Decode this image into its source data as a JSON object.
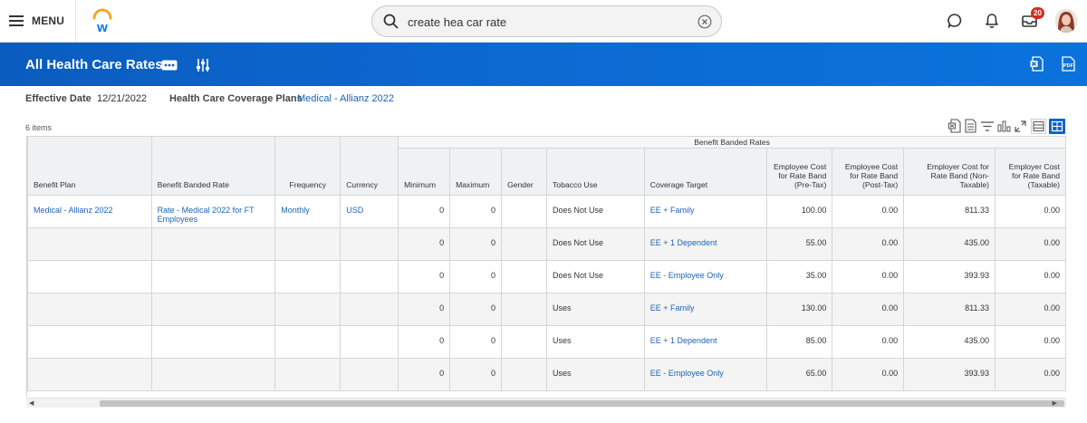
{
  "topbar": {
    "menu_label": "MENU",
    "search_value": "create hea car rate",
    "notification_count": "20"
  },
  "header": {
    "title": "All Health Care Rates"
  },
  "filters": {
    "effective_date_label": "Effective Date",
    "effective_date_value": "12/21/2022",
    "plans_label": "Health Care Coverage Plans",
    "plans_value": "Medical - Allianz 2022"
  },
  "grid": {
    "item_count": "6 items",
    "group_header": "Benefit Banded Rates",
    "columns": [
      "Benefit Plan",
      "Benefit Banded Rate",
      "Frequency",
      "Currency",
      "Minimum",
      "Maximum",
      "Gender",
      "Tobacco Use",
      "Coverage Target",
      "Employee Cost for Rate Band (Pre-Tax)",
      "Employee Cost for Rate Band (Post-Tax)",
      "Employer Cost for Rate Band (Non-Taxable)",
      "Employer Cost for Rate Band (Taxable)"
    ],
    "rows": [
      {
        "plan": "Medical - Allianz 2022",
        "rate": "Rate - Medical 2022 for FT Employees",
        "frequency": "Monthly",
        "currency": "USD",
        "min": "0",
        "max": "0",
        "gender": "",
        "tobacco": "Does Not Use",
        "target": "EE + Family",
        "ee_pre": "100.00",
        "ee_post": "0.00",
        "er_nontax": "811.33",
        "er_tax": "0.00"
      },
      {
        "plan": "",
        "rate": "",
        "frequency": "",
        "currency": "",
        "min": "0",
        "max": "0",
        "gender": "",
        "tobacco": "Does Not Use",
        "target": "EE + 1 Dependent",
        "ee_pre": "55.00",
        "ee_post": "0.00",
        "er_nontax": "435.00",
        "er_tax": "0.00"
      },
      {
        "plan": "",
        "rate": "",
        "frequency": "",
        "currency": "",
        "min": "0",
        "max": "0",
        "gender": "",
        "tobacco": "Does Not Use",
        "target": "EE - Employee Only",
        "ee_pre": "35.00",
        "ee_post": "0.00",
        "er_nontax": "393.93",
        "er_tax": "0.00"
      },
      {
        "plan": "",
        "rate": "",
        "frequency": "",
        "currency": "",
        "min": "0",
        "max": "0",
        "gender": "",
        "tobacco": "Uses",
        "target": "EE + Family",
        "ee_pre": "130.00",
        "ee_post": "0.00",
        "er_nontax": "811.33",
        "er_tax": "0.00"
      },
      {
        "plan": "",
        "rate": "",
        "frequency": "",
        "currency": "",
        "min": "0",
        "max": "0",
        "gender": "",
        "tobacco": "Uses",
        "target": "EE + 1 Dependent",
        "ee_pre": "85.00",
        "ee_post": "0.00",
        "er_nontax": "435.00",
        "er_tax": "0.00"
      },
      {
        "plan": "",
        "rate": "",
        "frequency": "",
        "currency": "",
        "min": "0",
        "max": "0",
        "gender": "",
        "tobacco": "Uses",
        "target": "EE - Employee Only",
        "ee_pre": "65.00",
        "ee_post": "0.00",
        "er_nontax": "393.93",
        "er_tax": "0.00"
      }
    ]
  },
  "icons": {
    "menu": "hamburger-icon",
    "logo": "workday-logo",
    "search": "search-icon",
    "clear": "clear-icon",
    "chat": "chat-icon",
    "bell": "bell-icon",
    "inbox": "inbox-icon",
    "related_actions": "ellipsis-icon",
    "related_filters": "filter-sliders-icon",
    "excel": "export-excel-icon",
    "pdf": "export-pdf-icon"
  },
  "colors": {
    "header_blue": "#0a66cc",
    "link_blue": "#1d63b5",
    "badge_red": "#d52b1e",
    "logo_orange": "#f5a623"
  }
}
